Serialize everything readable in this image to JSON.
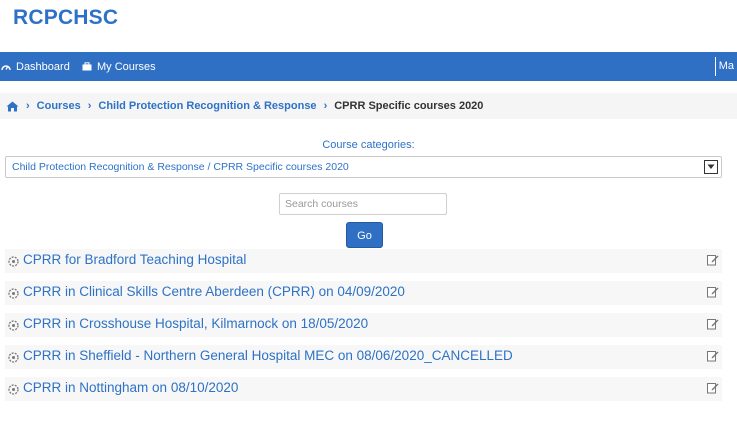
{
  "brand": "RCPCHSC",
  "nav": {
    "dashboard": "Dashboard",
    "my_courses": "My Courses",
    "menu_label": "Ma"
  },
  "breadcrumb": {
    "items": [
      "Courses",
      "Child Protection Recognition & Response"
    ],
    "current": "CPRR Specific courses 2020"
  },
  "category": {
    "label": "Course categories:",
    "selected": "Child Protection Recognition & Response / CPRR Specific courses 2020"
  },
  "search": {
    "placeholder": "Search courses",
    "go_label": "Go"
  },
  "courses": [
    "CPRR for Bradford Teaching Hospital",
    "CPRR in Clinical Skills Centre Aberdeen (CPRR) on 04/09/2020",
    "CPRR in Crosshouse Hospital, Kilmarnock on 18/05/2020",
    "CPRR in Sheffield - Northern General Hospital MEC on 08/06/2020_CANCELLED",
    "CPRR in Nottingham on 08/10/2020"
  ],
  "colors": {
    "brand": "#2d72c6",
    "navbar": "#2f6fc4"
  }
}
